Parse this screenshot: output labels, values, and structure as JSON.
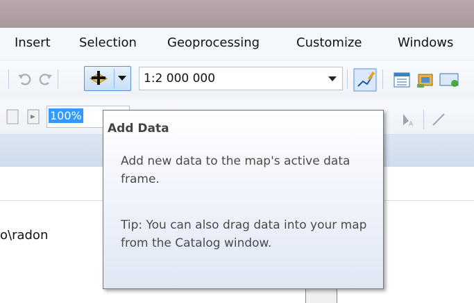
{
  "menubar": {
    "items": [
      "Insert",
      "Selection",
      "Geoprocessing",
      "Customize",
      "Windows"
    ]
  },
  "toolbar": {
    "scale_value": "1:2 000 000",
    "zoom_value": "100%",
    "icons": [
      "undo-icon",
      "redo-icon",
      "add-data-icon",
      "dropdown-arrow-icon",
      "editor-toolbar-icon",
      "table-of-contents-icon",
      "catalog-icon",
      "search-icon"
    ]
  },
  "tooltip": {
    "title": "Add Data",
    "description": "Add new data to the map's active data frame.",
    "tip": "Tip: You can also drag data into your map from the Catalog window."
  },
  "panel": {
    "path": "o\\radon"
  },
  "colors": {
    "accent": "#3399ff",
    "titlebar": "#b0a1a5",
    "tooltip_border": "#767676"
  }
}
